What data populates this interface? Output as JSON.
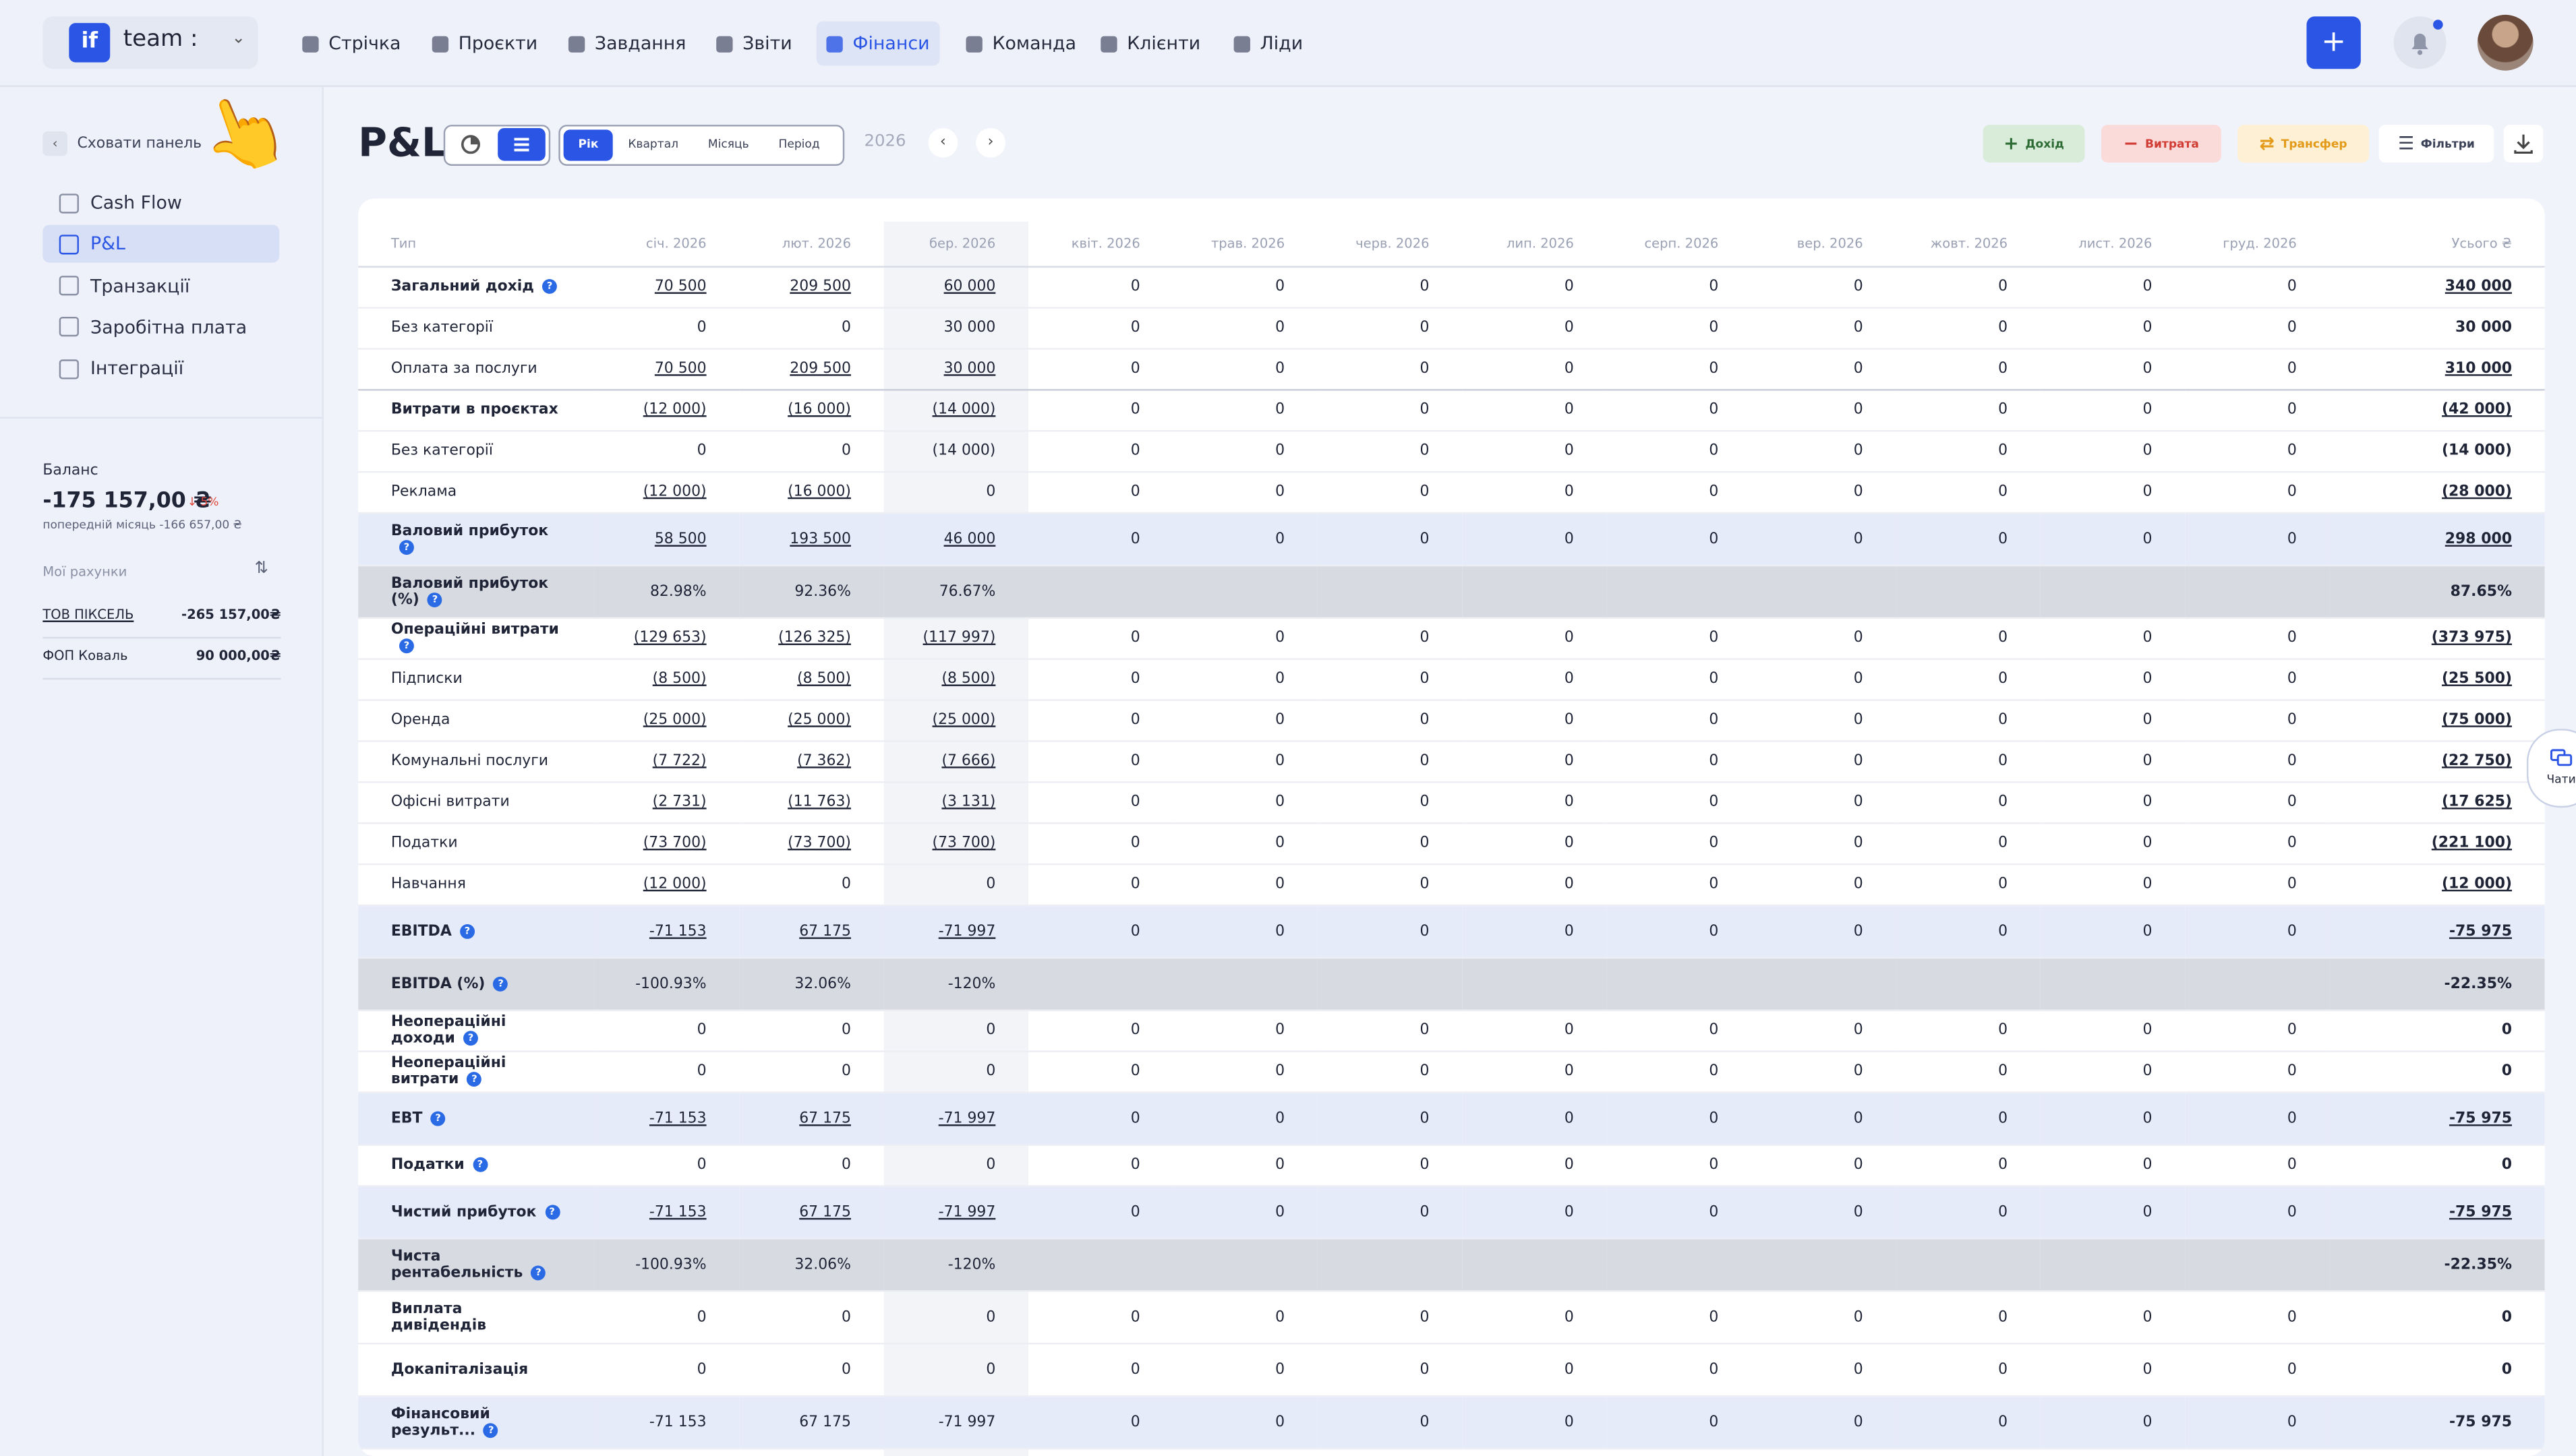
{
  "topnav": {
    "brand_logo": "if",
    "brand_name": "team :",
    "items": [
      {
        "label": "Стрічка",
        "icon": "home-icon"
      },
      {
        "label": "Проєкти",
        "icon": "file-icon"
      },
      {
        "label": "Завдання",
        "icon": "check-circle-icon"
      },
      {
        "label": "Звіти",
        "icon": "report-icon"
      },
      {
        "label": "Фінанси",
        "icon": "wallet-icon",
        "active": true
      },
      {
        "label": "Команда",
        "icon": "user-icon"
      },
      {
        "label": "Клієнти",
        "icon": "users-icon"
      },
      {
        "label": "Ліди",
        "icon": "link-icon"
      }
    ],
    "plus": "+"
  },
  "sidebar": {
    "collapse_label": "Сховати панель",
    "items": [
      {
        "label": "Cash Flow",
        "icon": "bar-chart-icon"
      },
      {
        "label": "P&L",
        "icon": "calendar-icon",
        "active": true
      },
      {
        "label": "Транзакції",
        "icon": "card-icon"
      },
      {
        "label": "Заробітна плата",
        "icon": "payroll-icon"
      },
      {
        "label": "Інтеграції",
        "icon": "sync-icon"
      }
    ],
    "balance_label": "Баланс",
    "balance_value": "-175 157,00 ₴",
    "balance_delta": "↓ 5%",
    "balance_prev": "попередній місяць -166 657,00 ₴",
    "accounts_label": "Мої рахунки",
    "accounts": [
      {
        "name": "ТОВ ПІКСЕЛЬ",
        "value": "-265 157,00₴"
      },
      {
        "name": "ФОП Коваль",
        "value": "90 000,00₴"
      }
    ]
  },
  "header": {
    "title": "P&L",
    "periods": [
      "Рік",
      "Квартал",
      "Місяць",
      "Період"
    ],
    "year": "2026",
    "income": "Дохід",
    "expense": "Витрата",
    "transfer": "Трансфер",
    "filters": "Фільтри",
    "colors": {
      "accent": "#2a55e5",
      "income_bg": "#d9ecd9",
      "expense_bg": "#fbdada",
      "transfer_bg": "#fdf0d4"
    }
  },
  "table": {
    "columns": [
      "Тип",
      "січ. 2026",
      "лют. 2026",
      "бер. 2026",
      "квіт. 2026",
      "трав. 2026",
      "черв. 2026",
      "лип. 2026",
      "серп. 2026",
      "вер. 2026",
      "жовт. 2026",
      "лист. 2026",
      "груд. 2026",
      "Усього ₴"
    ],
    "rows": [
      {
        "label": "Загальний дохід",
        "bold": true,
        "help": true,
        "vals": [
          "70 500",
          "209 500",
          "60 000"
        ],
        "total": "340 000",
        "u": true
      },
      {
        "label": "Без категорії",
        "vals": [
          "0",
          "0",
          "30 000"
        ],
        "total": "30 000"
      },
      {
        "label": "Оплата за послуги",
        "vals": [
          "70 500",
          "209 500",
          "30 000"
        ],
        "total": "310 000",
        "u": true,
        "end": true
      },
      {
        "label": "Витрати в проєктах",
        "bold": true,
        "vals": [
          "(12 000)",
          "(16 000)",
          "(14 000)"
        ],
        "total": "(42 000)",
        "u": true
      },
      {
        "label": "Без категорії",
        "vals": [
          "0",
          "0",
          "(14 000)"
        ],
        "total": "(14 000)"
      },
      {
        "label": "Реклама",
        "vals": [
          "(12 000)",
          "(16 000)",
          "0"
        ],
        "total": "(28 000)",
        "u": true
      },
      {
        "label": "Валовий прибуток",
        "bold": true,
        "help": true,
        "style": "blue",
        "vals": [
          "58 500",
          "193 500",
          "46 000"
        ],
        "total": "298 000",
        "u": true
      },
      {
        "label": "Валовий прибуток (%)",
        "bold": true,
        "help": true,
        "style": "gray",
        "pct": true,
        "vals": [
          "82.98%",
          "92.36%",
          "76.67%"
        ],
        "total": "87.65%"
      },
      {
        "label": "Операційні витрати",
        "bold": true,
        "help": true,
        "vals": [
          "(129 653)",
          "(126 325)",
          "(117 997)"
        ],
        "total": "(373 975)",
        "u": true
      },
      {
        "label": "Підписки",
        "vals": [
          "(8 500)",
          "(8 500)",
          "(8 500)"
        ],
        "total": "(25 500)",
        "u": true
      },
      {
        "label": "Оренда",
        "vals": [
          "(25 000)",
          "(25 000)",
          "(25 000)"
        ],
        "total": "(75 000)",
        "u": true
      },
      {
        "label": "Комунальні послуги",
        "vals": [
          "(7 722)",
          "(7 362)",
          "(7 666)"
        ],
        "total": "(22 750)",
        "u": true
      },
      {
        "label": "Офісні витрати",
        "vals": [
          "(2 731)",
          "(11 763)",
          "(3 131)"
        ],
        "total": "(17 625)",
        "u": true
      },
      {
        "label": "Податки",
        "vals": [
          "(73 700)",
          "(73 700)",
          "(73 700)"
        ],
        "total": "(221 100)",
        "u": true
      },
      {
        "label": "Навчання",
        "vals": [
          "(12 000)",
          "0",
          "0"
        ],
        "total": "(12 000)",
        "u": true
      },
      {
        "label": "EBITDA",
        "bold": true,
        "help": true,
        "style": "blue",
        "vals": [
          "-71 153",
          "67 175",
          "-71 997"
        ],
        "total": "-75 975",
        "u": true
      },
      {
        "label": "EBITDA (%)",
        "bold": true,
        "help": true,
        "style": "gray",
        "pct": true,
        "vals": [
          "-100.93%",
          "32.06%",
          "-120%"
        ],
        "total": "-22.35%"
      },
      {
        "label": "Неопераційні доходи",
        "bold": true,
        "help": true,
        "vals": [
          "0",
          "0",
          "0"
        ],
        "total": "0"
      },
      {
        "label": "Неопераційні витрати",
        "bold": true,
        "help": true,
        "vals": [
          "0",
          "0",
          "0"
        ],
        "total": "0"
      },
      {
        "label": "EBT",
        "bold": true,
        "help": true,
        "style": "blue",
        "vals": [
          "-71 153",
          "67 175",
          "-71 997"
        ],
        "total": "-75 975",
        "u": true
      },
      {
        "label": "Податки",
        "bold": true,
        "help": true,
        "vals": [
          "0",
          "0",
          "0"
        ],
        "total": "0"
      },
      {
        "label": "Чистий прибуток",
        "bold": true,
        "help": true,
        "style": "blue",
        "vals": [
          "-71 153",
          "67 175",
          "-71 997"
        ],
        "total": "-75 975",
        "u": true
      },
      {
        "label": "Чиста рентабельність",
        "bold": true,
        "help": true,
        "style": "gray",
        "pct": true,
        "vals": [
          "-100.93%",
          "32.06%",
          "-120%"
        ],
        "total": "-22.35%"
      },
      {
        "label": "Виплата дивідендів",
        "bold": true,
        "style": "tall",
        "vals": [
          "0",
          "0",
          "0"
        ],
        "total": "0"
      },
      {
        "label": "Докапіталізація",
        "bold": true,
        "style": "tall",
        "vals": [
          "0",
          "0",
          "0"
        ],
        "total": "0"
      },
      {
        "label": "Фінансовий результ...",
        "bold": true,
        "help": true,
        "style": "blue",
        "vals": [
          "-71 153",
          "67 175",
          "-71 997"
        ],
        "total": "-75 975"
      }
    ],
    "zero": "0"
  },
  "chat_label": "Чати"
}
